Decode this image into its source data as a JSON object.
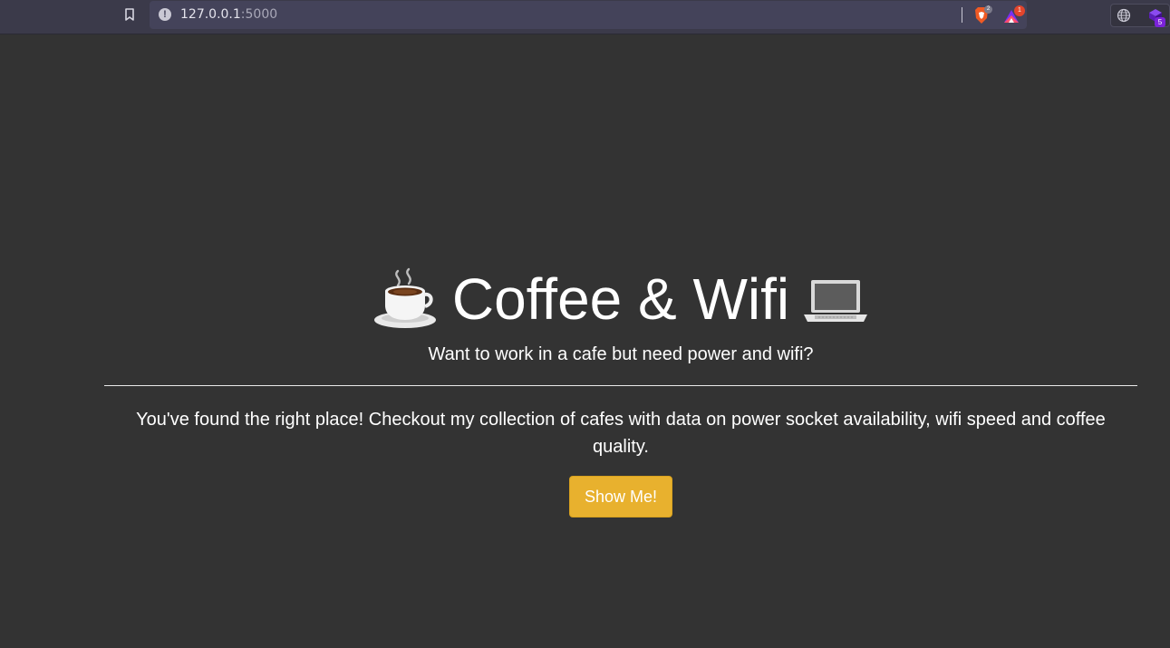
{
  "browser": {
    "url_host": "127.0.0.1",
    "url_port": ":5000",
    "brave_shield_count": "2",
    "rewards_count": "1",
    "extension_count": "5"
  },
  "hero": {
    "title": "Coffee & Wifi",
    "title_icon_left": "coffee-cup-icon",
    "title_icon_right": "laptop-icon",
    "subtitle": "Want to work in a cafe but need power and wifi?",
    "lead": "You've found the right place! Checkout my collection of cafes with data on power socket availability, wifi speed and coffee quality.",
    "button_label": "Show Me!"
  },
  "colors": {
    "page_background": "#333333",
    "button": "#e8b12e",
    "text": "#ffffff"
  }
}
